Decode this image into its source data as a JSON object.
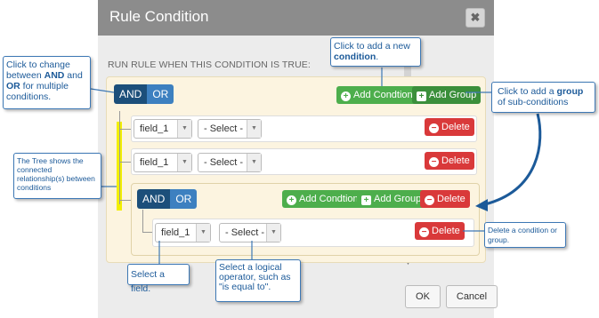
{
  "dialog": {
    "title": "Rule Condition",
    "close_label": "✖",
    "run_rule_label": "RUN RULE WHEN THIS CONDITION IS TRUE:"
  },
  "group": {
    "and_label": "AND",
    "or_label": "OR",
    "add_condition_label": "Add Condtion",
    "add_group_label": "Add Group",
    "rules": [
      {
        "field": "field_1",
        "operator": "- Select -",
        "delete_label": "Delete"
      },
      {
        "field": "field_1",
        "operator": "- Select -",
        "delete_label": "Delete"
      }
    ]
  },
  "subgroup": {
    "and_label": "AND",
    "or_label": "OR",
    "add_condition_label": "Add Condtion",
    "add_group_label": "Add Group",
    "delete_label": "Delete",
    "rules": [
      {
        "field": "field_1",
        "operator": "- Select -",
        "delete_label": "Delete"
      }
    ]
  },
  "footer": {
    "ok_label": "OK",
    "cancel_label": "Cancel"
  },
  "callouts": {
    "and_or": {
      "pre": "Click to change between ",
      "b1": "AND",
      "mid": " and ",
      "b2": "OR",
      "post": " for multiple conditions."
    },
    "add_condition": {
      "pre": "Click to add a new ",
      "b": "condition",
      "post": "."
    },
    "add_group": {
      "pre": "Click to add a ",
      "b": "group",
      "post": " of sub-conditions"
    },
    "tree": "The Tree shows the connected relationship(s) between conditions",
    "delete": "Delete a condition or group.",
    "field": "Select a field.",
    "operator": "Select a logical operator, such as \"is equal to\"."
  },
  "colors": {
    "accent": "#3d78b5",
    "add_green": "#4dae4c",
    "delete_red": "#d9393a",
    "and_dark": "#1c4f7a",
    "or_blue": "#3d80c0",
    "tree_yellow": "#f2ef00"
  }
}
